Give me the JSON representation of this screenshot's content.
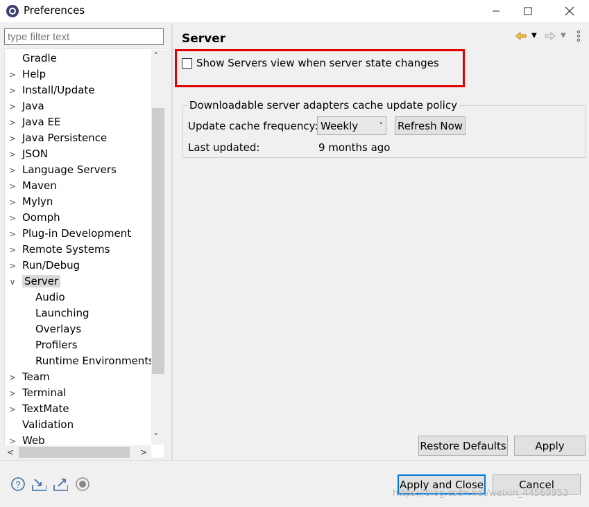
{
  "window": {
    "title": "Preferences",
    "minimize_icon": "minimize-icon",
    "maximize_icon": "maximize-icon",
    "close_icon": "close-icon"
  },
  "filter": {
    "placeholder": "type filter text"
  },
  "tree": {
    "items": [
      {
        "label": "Gradle",
        "expandable": false
      },
      {
        "label": "Help",
        "expandable": true
      },
      {
        "label": "Install/Update",
        "expandable": true
      },
      {
        "label": "Java",
        "expandable": true
      },
      {
        "label": "Java EE",
        "expandable": true
      },
      {
        "label": "Java Persistence",
        "expandable": true
      },
      {
        "label": "JSON",
        "expandable": true
      },
      {
        "label": "Language Servers",
        "expandable": true
      },
      {
        "label": "Maven",
        "expandable": true
      },
      {
        "label": "Mylyn",
        "expandable": true
      },
      {
        "label": "Oomph",
        "expandable": true
      },
      {
        "label": "Plug-in Development",
        "expandable": true
      },
      {
        "label": "Remote Systems",
        "expandable": true
      },
      {
        "label": "Run/Debug",
        "expandable": true
      },
      {
        "label": "Server",
        "expandable": true,
        "expanded": true,
        "selected": true
      },
      {
        "label": "Audio",
        "child": true
      },
      {
        "label": "Launching",
        "child": true
      },
      {
        "label": "Overlays",
        "child": true
      },
      {
        "label": "Profilers",
        "child": true
      },
      {
        "label": "Runtime Environments",
        "child": true
      },
      {
        "label": "Team",
        "expandable": true
      },
      {
        "label": "Terminal",
        "expandable": true
      },
      {
        "label": "TextMate",
        "expandable": true
      },
      {
        "label": "Validation",
        "expandable": false
      },
      {
        "label": "Web",
        "expandable": true
      }
    ]
  },
  "page": {
    "title": "Server",
    "show_servers_checkbox": {
      "label": "Show Servers view when server state changes",
      "checked": false
    },
    "group": {
      "title": "Downloadable server adapters cache update policy",
      "frequency_label": "Update cache frequency:",
      "frequency_value": "Weekly",
      "refresh_label": "Refresh Now",
      "last_updated_label": "Last updated:",
      "last_updated_value": "9 months ago"
    },
    "restore_defaults_label": "Restore Defaults",
    "apply_label": "Apply"
  },
  "footer": {
    "apply_close_label": "Apply and Close",
    "cancel_label": "Cancel",
    "watermark": "https://blog.csdn.net/weixin_44569953"
  },
  "colors": {
    "highlight": "#e00000",
    "default_button_border": "#0078d7"
  }
}
